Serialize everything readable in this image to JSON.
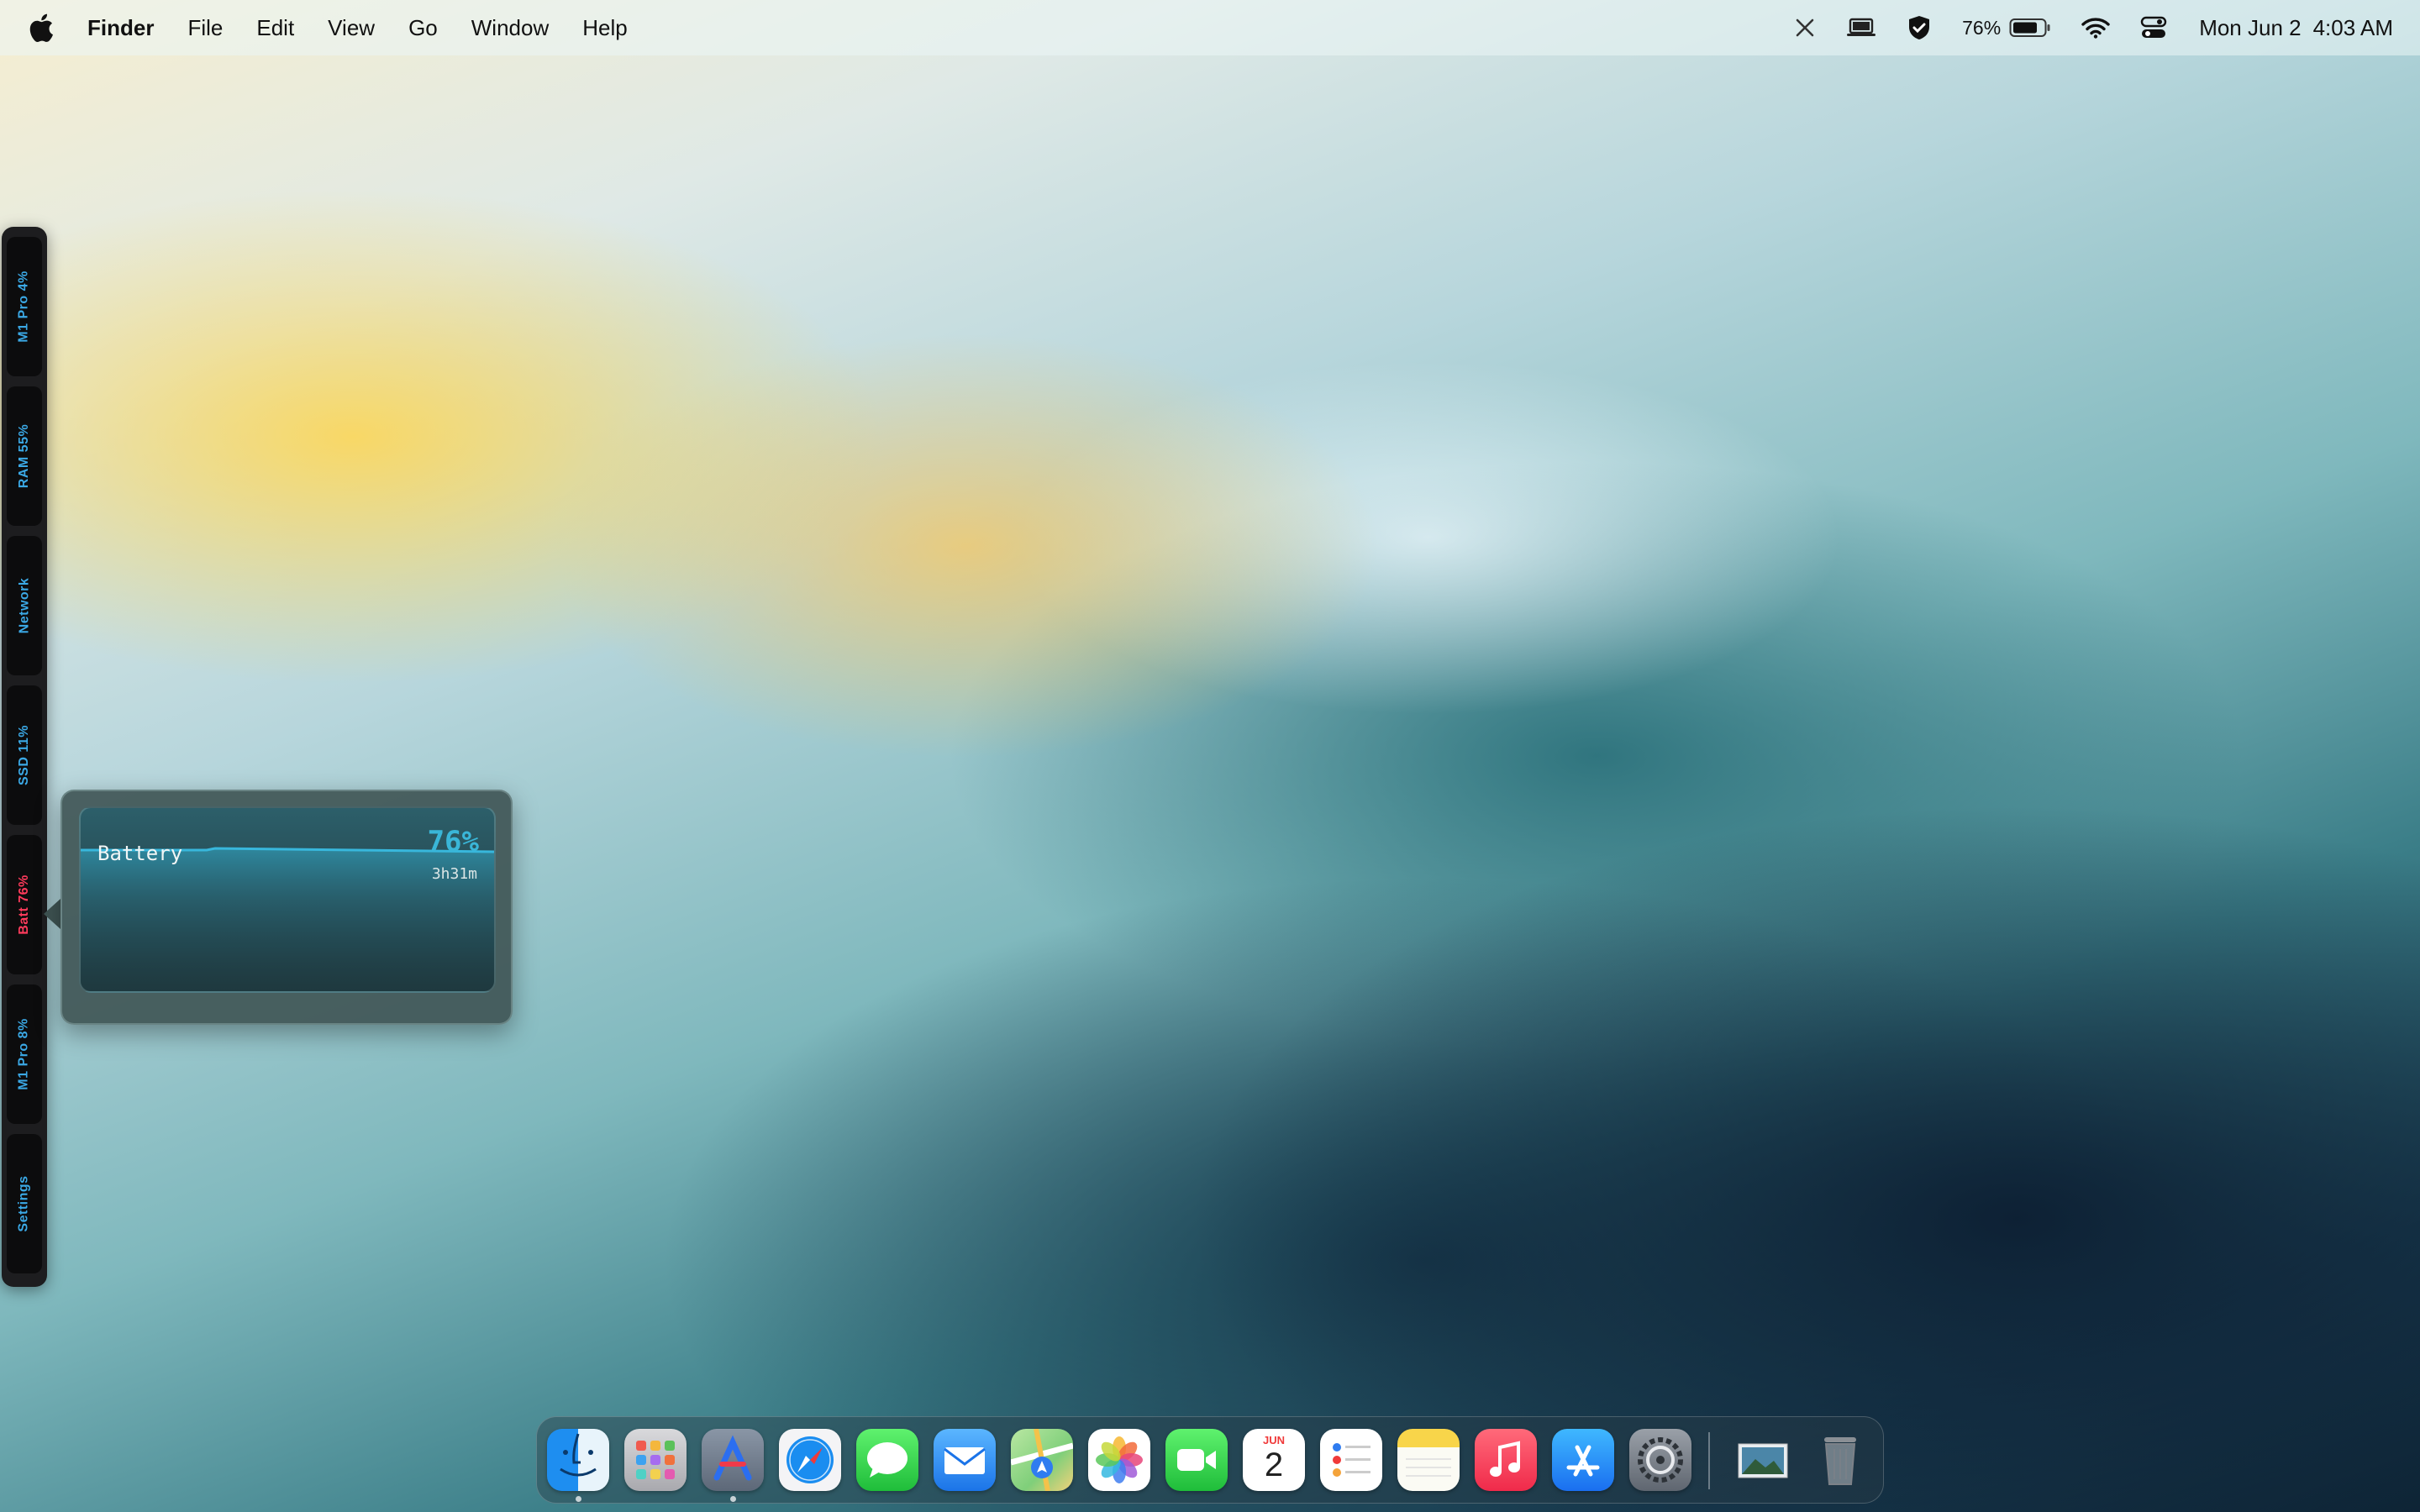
{
  "menubar": {
    "app_name": "Finder",
    "items": [
      "File",
      "Edit",
      "View",
      "Go",
      "Window",
      "Help"
    ],
    "battery_percent": "76%",
    "date": "Mon Jun 2",
    "time": "4:03 AM",
    "status_icons": [
      "close-icon",
      "laptop-icon",
      "shield-icon",
      "battery-icon",
      "wifi-icon",
      "control-center-icon"
    ]
  },
  "sidebar": {
    "tabs": [
      "M1 Pro 4%",
      "RAM 55%",
      "Network",
      "SSD 11%",
      "Batt 76%",
      "M1 Pro 8%",
      "Settings"
    ],
    "active_index": 4,
    "label_color": "#3ba9e6",
    "active_color": "#ff3b5c"
  },
  "battery_popover": {
    "title": "Battery",
    "percent": "76%",
    "time_remaining": "3h31m",
    "level": 0.76
  },
  "dock": {
    "apps": [
      "finder-icon",
      "launchpad-icon",
      "instruments-icon",
      "safari-icon",
      "messages-icon",
      "mail-icon",
      "maps-icon",
      "photos-icon",
      "facetime-icon",
      "calendar-icon",
      "reminders-icon",
      "notes-icon",
      "music-icon",
      "app-store-icon",
      "system-settings-icon",
      "preview-stack-icon",
      "trash-icon"
    ],
    "calendar_month": "JUN",
    "calendar_day": "2"
  }
}
